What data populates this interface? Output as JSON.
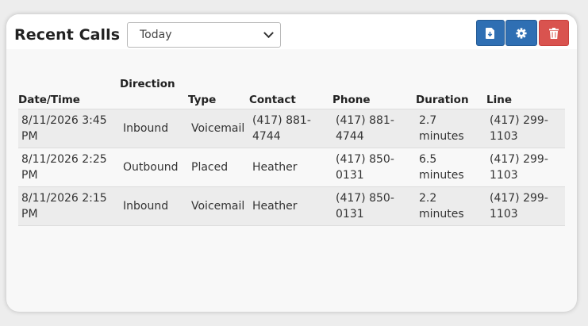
{
  "widget": {
    "title": "Recent Calls",
    "period_select": {
      "selected": "Today"
    },
    "buttons": {
      "download_icon": "download-file-icon",
      "settings_icon": "gear-icon",
      "delete_icon": "trash-icon"
    },
    "colors": {
      "primary": "#2f6fb3",
      "danger": "#d9534f"
    }
  },
  "table": {
    "headers": [
      "Date/Time",
      "Direction",
      "Type",
      "Contact",
      "Phone",
      "Duration",
      "Line"
    ],
    "rows": [
      [
        "8/11/2026 3:45 PM",
        "Inbound",
        "Voicemail",
        "(417) 881-4744",
        "(417) 881-4744",
        "2.7 minutes",
        "(417) 299-1103"
      ],
      [
        "8/11/2026 2:25 PM",
        "Outbound",
        "Placed",
        "Heather",
        "(417) 850-0131",
        "6.5 minutes",
        "(417) 299-1103"
      ],
      [
        "8/11/2026 2:15 PM",
        "Inbound",
        "Voicemail",
        "Heather",
        "(417) 850-0131",
        "2.2 minutes",
        "(417) 299-1103"
      ]
    ]
  }
}
